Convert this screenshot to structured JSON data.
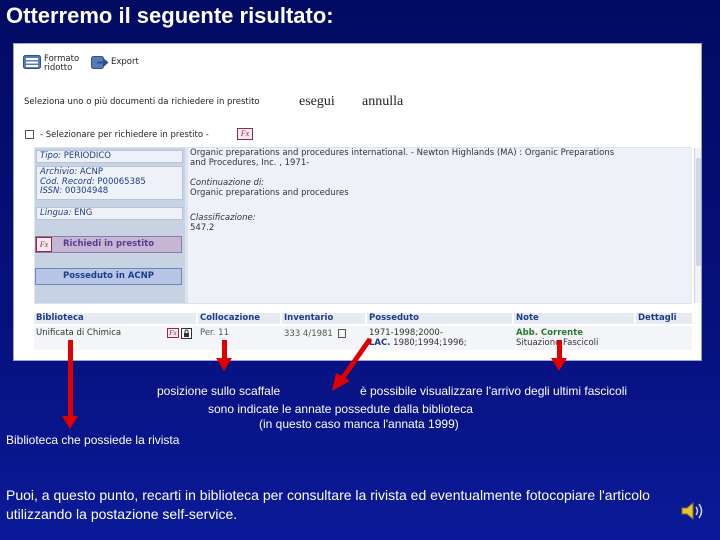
{
  "slide": {
    "title": "Otterremo il seguente risultato:",
    "footer": "Puoi, a questo punto, recarti in biblioteca per consultare la rivista ed eventualmente fotocopiare l'articolo utilizzando la postazione self-service."
  },
  "toolbar": {
    "format_label_line1": "Formato",
    "format_label_line2": "ridotto",
    "export_label": "Export"
  },
  "selection": {
    "prompt": "Seleziona uno o più documenti da richiedere in prestito",
    "execute_label": "esegui",
    "cancel_label": "annulla",
    "checkbox_label": "- Selezionare per richiedere in prestito -",
    "fx_label": "Fx"
  },
  "record": {
    "type_label": "Tipo:",
    "type_value": "PERIODICO",
    "archive_label": "Archivio:",
    "archive_value": "ACNP",
    "record_code_label": "Cod. Record:",
    "record_code_value": "P00065385",
    "issn_label": "ISSN:",
    "issn_value": "00304948",
    "language_label": "Lingua:",
    "language_value": "ENG",
    "title_text_line1": "Organic preparations and procedures international. - Newton Highlands (MA) : Organic Preparations",
    "title_text_line2": "and Procedures, Inc. , 1971-",
    "continuation_label": "Continuazione di:",
    "continuation_value": "Organic preparations and procedures",
    "classification_label": "Classificazione:",
    "classification_value": "547.2",
    "loan_fx": "Fx",
    "loan_button": "Richiedi in prestito",
    "holdings_button": "Posseduto in ACNP"
  },
  "table": {
    "headers": [
      "Biblioteca",
      "Collocazione",
      "Inventario",
      "Posseduto",
      "Note",
      "Dettagli"
    ],
    "row": {
      "biblioteca": "Unificata di Chimica",
      "fx": "Fx",
      "collocazione": "Per. 11",
      "inventario": "333 4/1981",
      "posseduto_line1": "1971-1998;2000-",
      "posseduto_line2_prefix": "LAC.",
      "posseduto_line2_rest": "1980;1994;1996;",
      "note_line1": "Abb. Corrente",
      "note_line2": "Situazione Fascicoli"
    }
  },
  "annotations": {
    "shelf_position": "posizione sullo scaffale",
    "latest_issues": "è possibile visualizzare l'arrivo degli ultimi fascicoli",
    "years_held_line1": "sono indicate le annate possedute dalla biblioteca",
    "years_held_line2": "(in questo caso manca l'annata 1999)",
    "library": "Biblioteca che possiede la rivista"
  },
  "colors": {
    "background": "#06107a",
    "arrow": "#e00000",
    "link_blue": "#1e3c8c",
    "loan_purple": "#c7b5d6",
    "note_green": "#2a7a2a"
  },
  "icons": {
    "format": "list-format-icon",
    "export": "export-arrow-icon",
    "sound": "speaker-icon",
    "lock": "padlock-icon"
  }
}
